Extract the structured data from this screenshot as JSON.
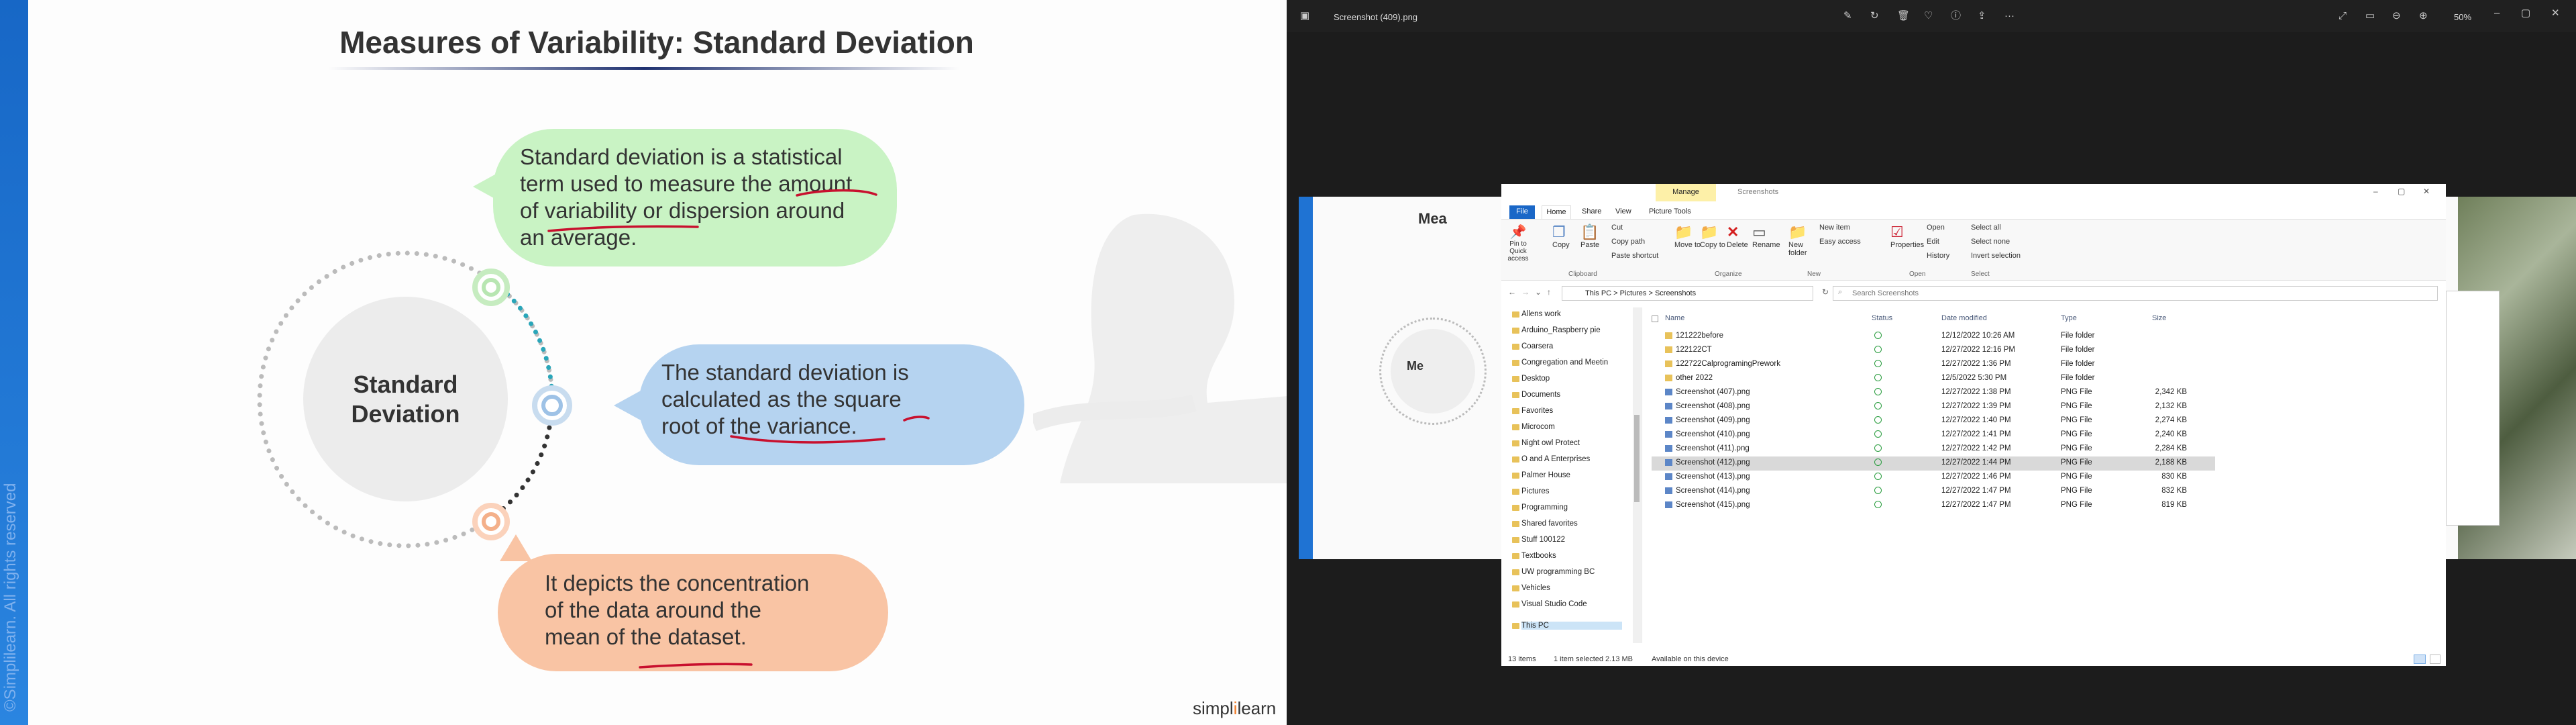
{
  "slide": {
    "title": "Measures of Variability: Standard Deviation",
    "watermark": "©Simplilearn. All rights reserved",
    "center_label_1": "Standard",
    "center_label_2": "Deviation",
    "bubble1": [
      "Standard deviation is a statistical",
      "term used to measure the amount",
      "of variability or dispersion around",
      "an average."
    ],
    "bubble2": [
      "The standard deviation is",
      "calculated as the square",
      "root of the variance."
    ],
    "bubble3": [
      "It depicts the concentration",
      "of the data around the",
      "mean of the dataset."
    ],
    "logo_a": "simpl",
    "logo_b": "i",
    "logo_c": "learn"
  },
  "viewer": {
    "filename": "Screenshot (409).png",
    "zoom": "50%",
    "behind_title": "Mea",
    "behind_center": "Me"
  },
  "explorer": {
    "manage_tab": "Manage",
    "title": "Screenshots",
    "tabs": [
      "File",
      "Home",
      "Share",
      "View",
      "Picture Tools"
    ],
    "ribbon": {
      "clipboard": [
        "Pin to Quick access",
        "Copy",
        "Paste",
        "Cut",
        "Copy path",
        "Paste shortcut"
      ],
      "organize": [
        "Move to",
        "Copy to",
        "Delete",
        "Rename"
      ],
      "new": [
        "New folder",
        "New item",
        "Easy access"
      ],
      "open": [
        "Properties",
        "Open",
        "Edit",
        "History"
      ],
      "select": [
        "Select all",
        "Select none",
        "Invert selection"
      ],
      "groups": [
        "Clipboard",
        "Organize",
        "New",
        "Open",
        "Select"
      ]
    },
    "breadcrumb": [
      "This PC",
      "Pictures",
      "Screenshots"
    ],
    "search_placeholder": "Search Screenshots",
    "columns": [
      "Name",
      "Status",
      "Date modified",
      "Type",
      "Size"
    ],
    "nav": [
      "Allens work",
      "Arduino_Raspberry pie",
      "Coarsera",
      "Congregation and Meetin",
      "Desktop",
      "Documents",
      "Favorites",
      "Microcom",
      "Night owl Protect",
      "O and A Enterprises",
      "Palmer House",
      "Pictures",
      "Programming",
      "Shared favorites",
      "Stuff 100122",
      "Textbooks",
      "UW programming BC",
      "Vehicles",
      "Visual Studio Code",
      "This PC"
    ],
    "files": [
      {
        "name": "121222before",
        "date": "12/12/2022 10:26 AM",
        "type": "File folder",
        "size": "",
        "folder": true
      },
      {
        "name": "122122CT",
        "date": "12/27/2022 12:16 PM",
        "type": "File folder",
        "size": "",
        "folder": true
      },
      {
        "name": "122722CalprogramingPrework",
        "date": "12/27/2022 1:36 PM",
        "type": "File folder",
        "size": "",
        "folder": true
      },
      {
        "name": "other 2022",
        "date": "12/5/2022 5:30 PM",
        "type": "File folder",
        "size": "",
        "folder": true
      },
      {
        "name": "Screenshot (407).png",
        "date": "12/27/2022 1:38 PM",
        "type": "PNG File",
        "size": "2,342 KB",
        "folder": false
      },
      {
        "name": "Screenshot (408).png",
        "date": "12/27/2022 1:39 PM",
        "type": "PNG File",
        "size": "2,132 KB",
        "folder": false
      },
      {
        "name": "Screenshot (409).png",
        "date": "12/27/2022 1:40 PM",
        "type": "PNG File",
        "size": "2,274 KB",
        "folder": false
      },
      {
        "name": "Screenshot (410).png",
        "date": "12/27/2022 1:41 PM",
        "type": "PNG File",
        "size": "2,240 KB",
        "folder": false
      },
      {
        "name": "Screenshot (411).png",
        "date": "12/27/2022 1:42 PM",
        "type": "PNG File",
        "size": "2,284 KB",
        "folder": false
      },
      {
        "name": "Screenshot (412).png",
        "date": "12/27/2022 1:44 PM",
        "type": "PNG File",
        "size": "2,188 KB",
        "folder": false,
        "selected": true
      },
      {
        "name": "Screenshot (413).png",
        "date": "12/27/2022 1:46 PM",
        "type": "PNG File",
        "size": "830 KB",
        "folder": false
      },
      {
        "name": "Screenshot (414).png",
        "date": "12/27/2022 1:47 PM",
        "type": "PNG File",
        "size": "832 KB",
        "folder": false
      },
      {
        "name": "Screenshot (415).png",
        "date": "12/27/2022 1:47 PM",
        "type": "PNG File",
        "size": "819 KB",
        "folder": false
      }
    ],
    "status": {
      "items": "13 items",
      "selected": "1 item selected 2.13 MB",
      "availability": "Available on this device"
    }
  }
}
